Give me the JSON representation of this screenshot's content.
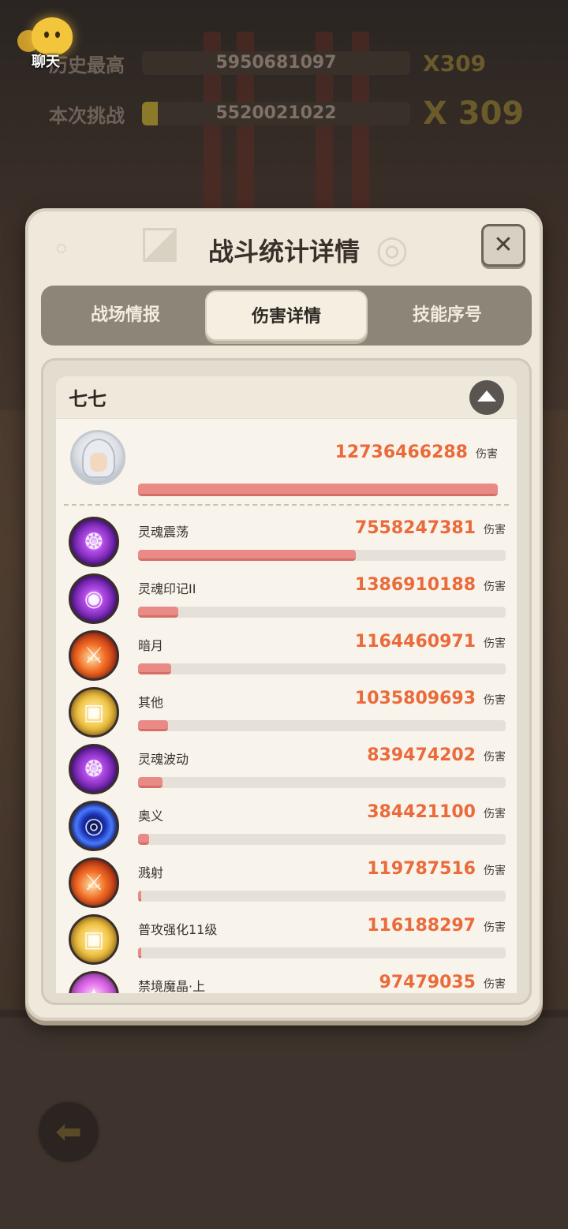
{
  "hud": {
    "chat_label": "聊天",
    "rows": [
      {
        "label": "历史最高",
        "value": "5950681097",
        "multiplier": "X309",
        "fill": 0.0
      },
      {
        "label": "本次挑战",
        "value": "5520021022",
        "multiplier": "X 309",
        "fill": 0.06
      }
    ]
  },
  "panel": {
    "title": "战斗统计详情",
    "close_symbol": "✕",
    "tabs": [
      {
        "label": "战场情报",
        "active": false
      },
      {
        "label": "伤害详情",
        "active": true
      },
      {
        "label": "技能序号",
        "active": false
      }
    ]
  },
  "hero": {
    "name": "七七",
    "total_damage": "12736466288",
    "unit": "伤害",
    "total_fill": 1.0
  },
  "skills": [
    {
      "name": "灵魂震荡",
      "damage": "7558247381",
      "unit": "伤害",
      "fill": 0.593,
      "icon": "soul-flame-icon",
      "color": "purple"
    },
    {
      "name": "灵魂印记II",
      "damage": "1386910188",
      "unit": "伤害",
      "fill": 0.109,
      "icon": "soul-spiral-icon",
      "color": "purple"
    },
    {
      "name": "暗月",
      "damage": "1164460971",
      "unit": "伤害",
      "fill": 0.091,
      "icon": "dagger-icon",
      "color": "fire"
    },
    {
      "name": "其他",
      "damage": "1035809693",
      "unit": "伤害",
      "fill": 0.081,
      "icon": "scroll-icon",
      "color": "gold"
    },
    {
      "name": "灵魂波动",
      "damage": "839474202",
      "unit": "伤害",
      "fill": 0.066,
      "icon": "soul-flame-icon",
      "color": "purple"
    },
    {
      "name": "奥义",
      "damage": "384421100",
      "unit": "伤害",
      "fill": 0.03,
      "icon": "vortex-icon",
      "color": "blue"
    },
    {
      "name": "溅射",
      "damage": "119787516",
      "unit": "伤害",
      "fill": 0.009,
      "icon": "dagger-icon",
      "color": "fire"
    },
    {
      "name": "普攻强化11级",
      "damage": "116188297",
      "unit": "伤害",
      "fill": 0.009,
      "icon": "scroll-icon",
      "color": "gold"
    },
    {
      "name": "禁境魔晶·上",
      "damage": "97479035",
      "unit": "伤害",
      "fill": 0.008,
      "icon": "crystal-icon",
      "color": "pink"
    }
  ],
  "colors": {
    "damage_text": "#ea6a3a",
    "bar_fill": "#e98a86",
    "bar_track": "#e6e1d8",
    "panel_bg": "#efe9dc",
    "tab_bar": "#8c8578"
  }
}
